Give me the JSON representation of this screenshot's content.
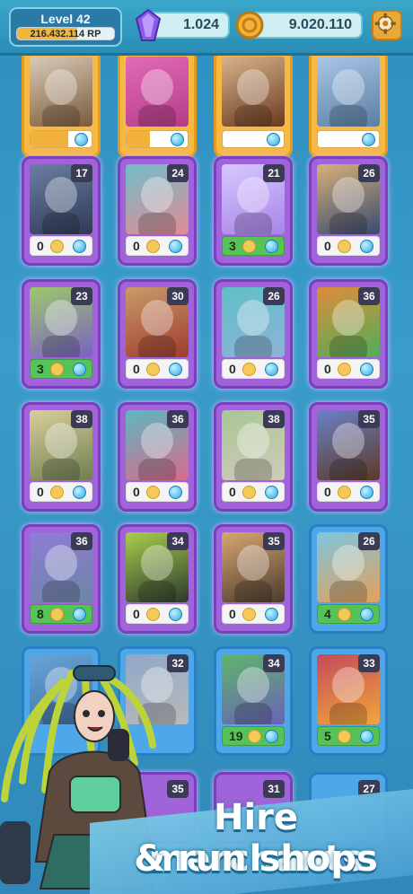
{
  "header": {
    "level_label": "Level 42",
    "rp_text": "216.432.114 RP",
    "rp_progress": 0.62,
    "gems": "1.024",
    "coins": "9.020.110",
    "settings_icon": "gear-icon",
    "gem_icon": "purple-crystal-icon",
    "coin_icon": "coin-icon"
  },
  "cards": [
    {
      "tier": "legend",
      "top": true,
      "progress": 0.62,
      "colors": [
        "#d9cbb8",
        "#7b5a3a"
      ]
    },
    {
      "tier": "legend",
      "top": true,
      "progress": 0.38,
      "colors": [
        "#e26bb6",
        "#b63c89"
      ]
    },
    {
      "tier": "legend",
      "top": true,
      "progress": 0.0,
      "colors": [
        "#d7b28c",
        "#6b3b1f"
      ]
    },
    {
      "tier": "legend",
      "top": true,
      "progress": 0.0,
      "colors": [
        "#a9c7e8",
        "#5b7ea3"
      ]
    },
    {
      "tier": "epic",
      "level": "17",
      "count": "0",
      "green": false,
      "colors": [
        "#6b7ea3",
        "#2f3a56"
      ]
    },
    {
      "tier": "epic",
      "level": "24",
      "count": "0",
      "green": false,
      "colors": [
        "#71bfc8",
        "#e28a95"
      ]
    },
    {
      "tier": "epic",
      "level": "21",
      "count": "3",
      "green": true,
      "colors": [
        "#d6c8ff",
        "#a884e8"
      ]
    },
    {
      "tier": "epic",
      "level": "26",
      "count": "0",
      "green": false,
      "colors": [
        "#d6b07a",
        "#3a4a72"
      ]
    },
    {
      "tier": "epic",
      "level": "23",
      "count": "3",
      "green": true,
      "colors": [
        "#9dc86b",
        "#7a62c3"
      ]
    },
    {
      "tier": "epic",
      "level": "30",
      "count": "0",
      "green": false,
      "colors": [
        "#c99b6a",
        "#a03b2e"
      ]
    },
    {
      "tier": "epic",
      "level": "26",
      "count": "0",
      "green": false,
      "colors": [
        "#5ec0c8",
        "#8fb2d8"
      ]
    },
    {
      "tier": "epic",
      "level": "36",
      "count": "0",
      "green": false,
      "colors": [
        "#e08c3a",
        "#4fae5a"
      ]
    },
    {
      "tier": "epic",
      "level": "38",
      "count": "0",
      "green": false,
      "colors": [
        "#d9cf9a",
        "#6f7f52"
      ]
    },
    {
      "tier": "epic",
      "level": "36",
      "count": "0",
      "green": false,
      "colors": [
        "#5cb8c1",
        "#d96a8b"
      ]
    },
    {
      "tier": "epic",
      "level": "38",
      "count": "0",
      "green": false,
      "colors": [
        "#a8c792",
        "#cfcabc"
      ]
    },
    {
      "tier": "epic",
      "level": "35",
      "count": "0",
      "green": false,
      "colors": [
        "#6b80c8",
        "#5b3a26"
      ]
    },
    {
      "tier": "epic",
      "level": "36",
      "count": "8",
      "green": true,
      "colors": [
        "#8f7bd6",
        "#6d86a8"
      ]
    },
    {
      "tier": "epic",
      "level": "34",
      "count": "0",
      "green": false,
      "colors": [
        "#a7cf4b",
        "#2d3a2e"
      ]
    },
    {
      "tier": "epic",
      "level": "35",
      "count": "0",
      "green": false,
      "colors": [
        "#d8a770",
        "#4c3a2f"
      ]
    },
    {
      "tier": "rare",
      "level": "26",
      "count": "4",
      "green": true,
      "colors": [
        "#7dc6df",
        "#e3a05a"
      ]
    },
    {
      "tier": "rare",
      "level": "",
      "count": "",
      "green": false,
      "colors": [
        "#6aa5d8",
        "#3f6fa3"
      ]
    },
    {
      "tier": "rare",
      "level": "32",
      "count": "",
      "green": false,
      "colors": [
        "#8fa8c8",
        "#b9b9b9"
      ]
    },
    {
      "tier": "rare",
      "level": "34",
      "count": "19",
      "green": true,
      "colors": [
        "#5fb56a",
        "#6a62b8"
      ]
    },
    {
      "tier": "rare",
      "level": "33",
      "count": "5",
      "green": true,
      "colors": [
        "#c44a5b",
        "#f1a63a"
      ]
    }
  ],
  "bottom_row": {
    "levels": [
      "35",
      "31",
      "27"
    ]
  },
  "promo": {
    "line1": "Hire merchants",
    "line2": "& run shops"
  }
}
